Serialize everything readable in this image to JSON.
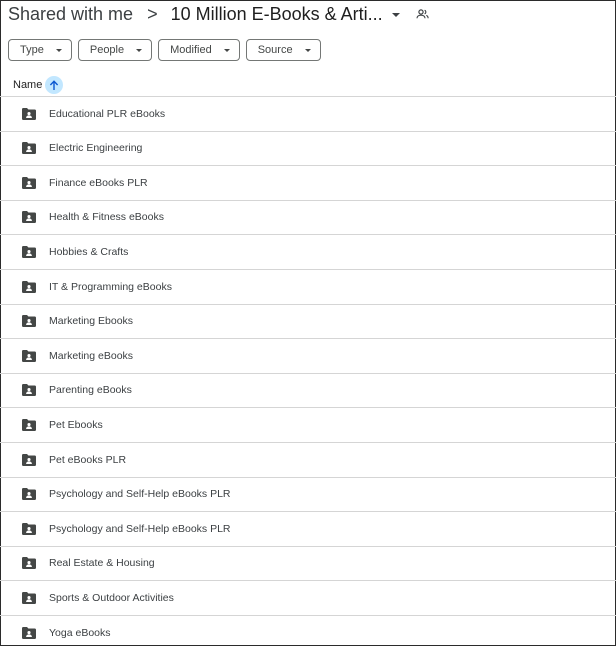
{
  "breadcrumb": {
    "root": "Shared with me",
    "separator": ">",
    "current": "10 Million E-Books & Arti..."
  },
  "filters": [
    {
      "label": "Type"
    },
    {
      "label": "People"
    },
    {
      "label": "Modified"
    },
    {
      "label": "Source"
    }
  ],
  "list_header": {
    "name_label": "Name",
    "sort_direction": "ascending"
  },
  "items": [
    {
      "name": "Educational PLR eBooks",
      "type": "shared-folder"
    },
    {
      "name": "Electric Engineering",
      "type": "shared-folder"
    },
    {
      "name": "Finance eBooks PLR",
      "type": "shared-folder"
    },
    {
      "name": "Health & Fitness eBooks",
      "type": "shared-folder"
    },
    {
      "name": "Hobbies & Crafts",
      "type": "shared-folder"
    },
    {
      "name": "IT & Programming eBooks",
      "type": "shared-folder"
    },
    {
      "name": "Marketing Ebooks",
      "type": "shared-folder"
    },
    {
      "name": "Marketing eBooks",
      "type": "shared-folder"
    },
    {
      "name": "Parenting eBooks",
      "type": "shared-folder"
    },
    {
      "name": "Pet Ebooks",
      "type": "shared-folder"
    },
    {
      "name": "Pet eBooks PLR",
      "type": "shared-folder"
    },
    {
      "name": "Psychology and Self-Help eBooks PLR",
      "type": "shared-folder"
    },
    {
      "name": "Psychology and Self-Help eBooks PLR",
      "type": "shared-folder"
    },
    {
      "name": "Real Estate & Housing",
      "type": "shared-folder"
    },
    {
      "name": "Sports & Outdoor Activities",
      "type": "shared-folder"
    },
    {
      "name": "Yoga eBooks",
      "type": "shared-folder"
    }
  ],
  "colors": {
    "sort_highlight": "#c2e7ff",
    "folder_icon": "#444746",
    "divider": "#d5d5d5"
  }
}
